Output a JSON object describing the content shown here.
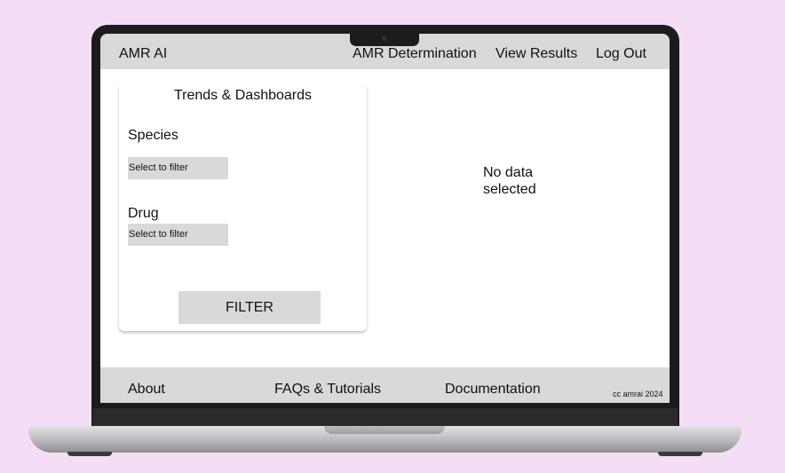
{
  "header": {
    "brand": "AMR AI",
    "nav": [
      "AMR Determination",
      "View Results",
      "Log Out"
    ]
  },
  "filters": {
    "title": "Trends & Dashboards",
    "species_label": "Species",
    "species_placeholder": "Select to filter",
    "drug_label": "Drug",
    "drug_placeholder": "Select to filter",
    "filter_button": "FILTER"
  },
  "results": {
    "empty_line1": "No data",
    "empty_line2": "selected"
  },
  "footer": {
    "links": [
      "About",
      "FAQs & Tutorials",
      "Documentation"
    ],
    "copyright": "cc amrai 2024"
  },
  "colors": {
    "background": "#f5ddf5",
    "bar": "#d9d9d9"
  }
}
